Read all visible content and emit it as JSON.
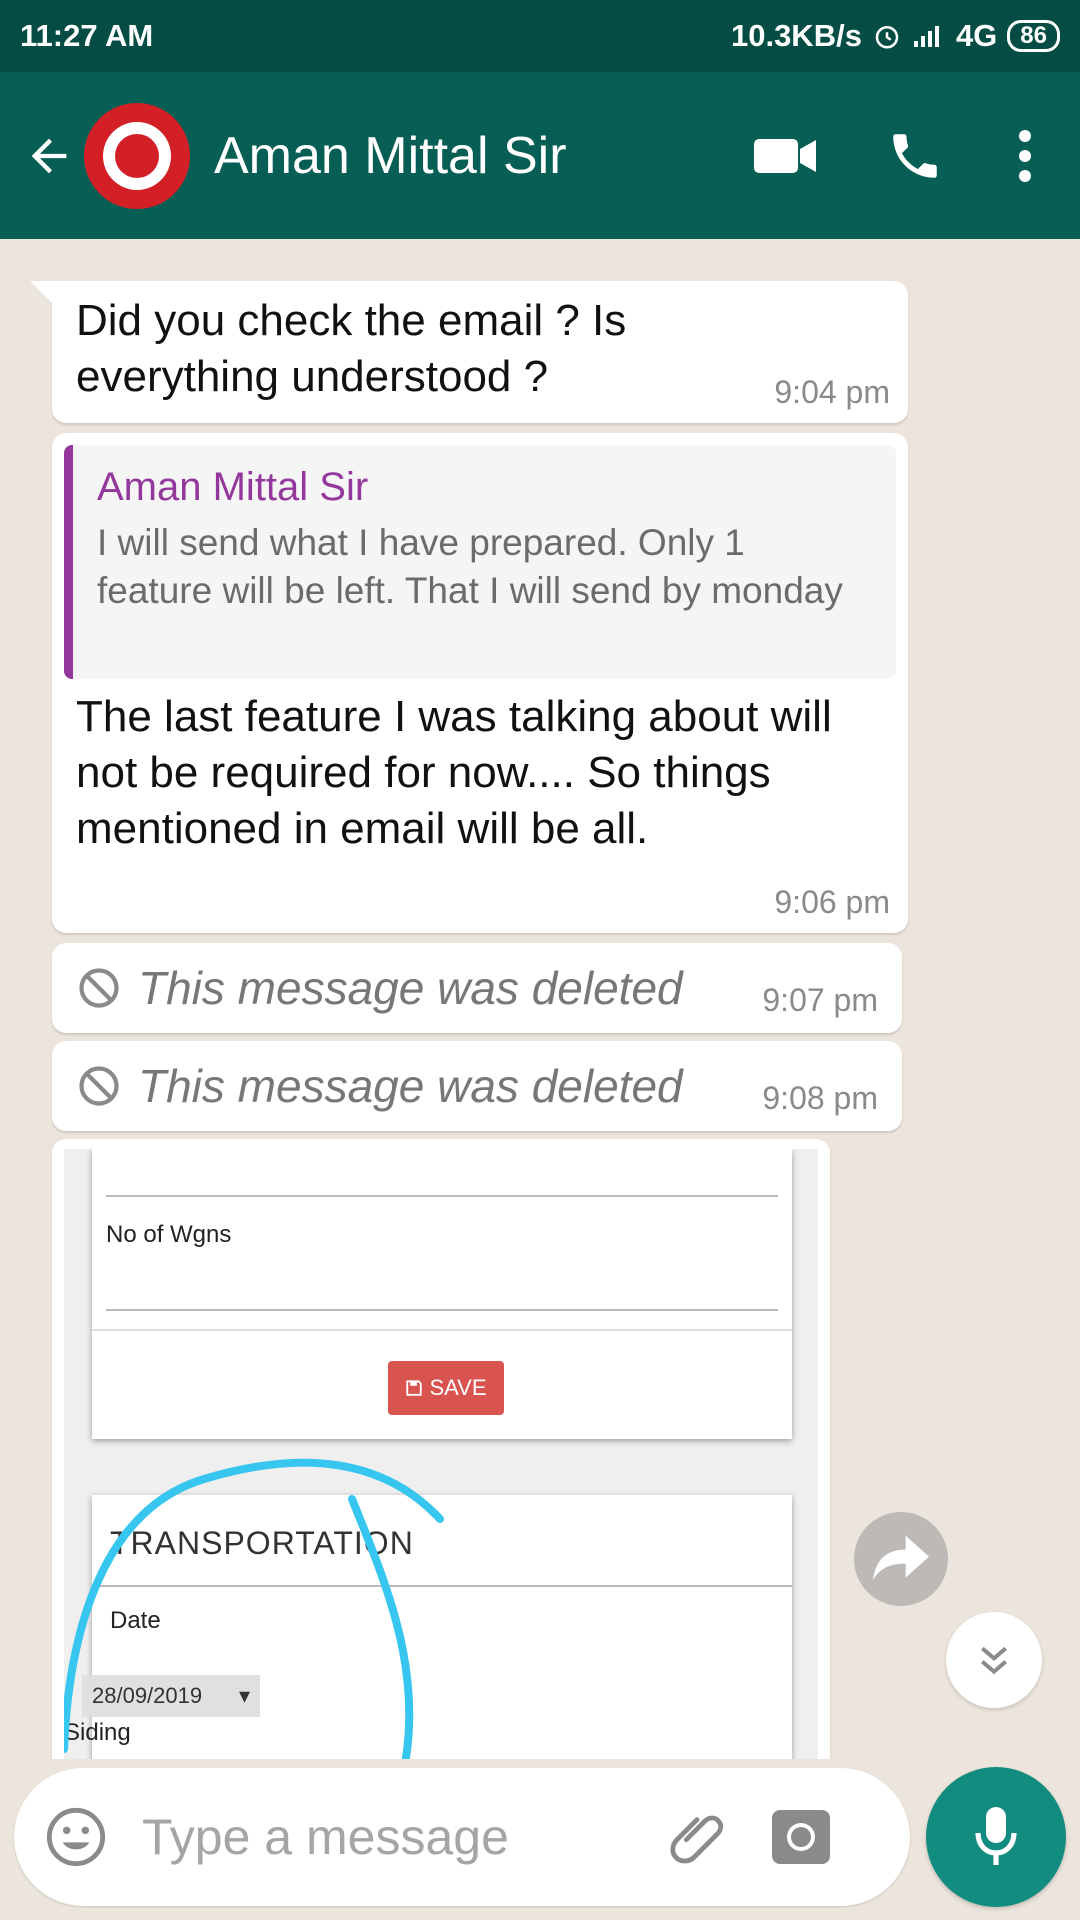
{
  "status_bar": {
    "time": "11:27 AM",
    "net_speed": "10.3KB/s",
    "network": "4G",
    "battery": "86"
  },
  "header": {
    "contact_name": "Aman Mittal Sir",
    "colors": {
      "header_bg": "#075e54",
      "status_bg": "#054d44"
    }
  },
  "messages": [
    {
      "text_line1": "Did you check the email ? Is",
      "text_line2": "everything understood ?",
      "time": "9:04 pm"
    },
    {
      "quote": {
        "author": "Aman Mittal Sir",
        "text": "I will send what I have prepared. Only 1 feature will be left. That I will send by monday"
      },
      "text": "The last feature I was talking about will not be required for now.... So things mentioned in email will be all.",
      "time": "9:06 pm"
    },
    {
      "deleted_text": "This message was deleted",
      "time": "9:07 pm"
    },
    {
      "deleted_text": "This message was deleted",
      "time": "9:08 pm"
    }
  ],
  "image_message": {
    "field_label": "No of Wgns",
    "save_label": "SAVE",
    "section_title": "TRANSPORTATION",
    "date_label": "Date",
    "date_value": "28/09/2019",
    "siding_label": "Siding"
  },
  "composer": {
    "placeholder": "Type a message"
  }
}
